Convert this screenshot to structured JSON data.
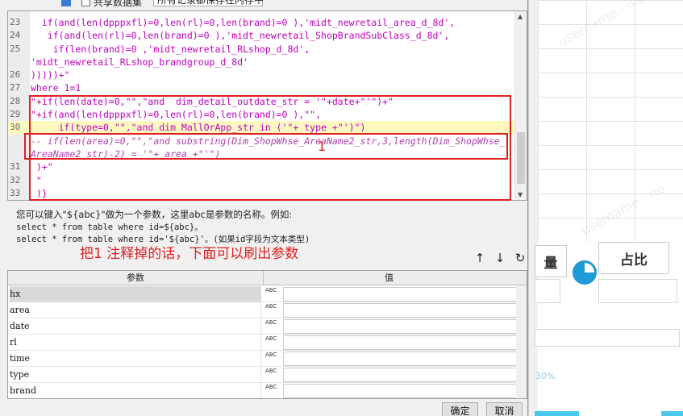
{
  "toolbar": {
    "share_label": "共享数据集",
    "records_dropdown": "所有记录都保存在内存中"
  },
  "editor": {
    "lines": [
      {
        "num": "23",
        "text": "  if(and(len(dpppxfl)=0,len(rl)=0,len(brand)=0 ),'midt_newretail_area_d_8d',"
      },
      {
        "num": "24",
        "text": "   if(and(len(rl)=0,len(brand)=0 ),'midt_newretail_ShopBrandSubClass_d_8d',"
      },
      {
        "num": "25",
        "text": "    if(len(brand)=0 ,'midt_newretail_RLshop_d_8d',"
      },
      {
        "num": "",
        "text": "'midt_newretail_RLshop_brandgroup_d_8d'"
      },
      {
        "num": "26",
        "text": ")))))+\""
      },
      {
        "num": "27",
        "text": "where 1=1"
      },
      {
        "num": "28",
        "text": "\"+if(len(date)=0,\"\",\"and  dim_detail_outdate_str = '\"+date+\"'\")+\""
      },
      {
        "num": "29",
        "text": "\"+if(and(len(dpppxfl)=0,len(rl)=0,len(brand)=0 ),\"\","
      },
      {
        "num": "30",
        "text": "     if(type=0,\"\",\"and dim MallOrApp_str in ('\"+ type +\"')\")"
      },
      {
        "num": "",
        "text": "-- if(len(area)=0,\"\",\"and substring(Dim_ShopWhse_AreaName2_str,3,length(Dim_ShopWhse_"
      },
      {
        "num": "",
        "text": "AreaName2_str)-2) = '\"+ area +\"'\")"
      },
      {
        "num": "31",
        "text": " )+\""
      },
      {
        "num": "32",
        "text": " \""
      },
      {
        "num": "33",
        "text": " )}"
      }
    ]
  },
  "annotation": {
    "marker": "1",
    "text": "把1 注释掉的话，下面可以刷出参数"
  },
  "hint": {
    "line1": "您可以键入\"${abc}\"做为一个参数，这里abc是参数的名称。例如:",
    "line2": "select * from table where id=${abc}。",
    "line3": "select * from table where id='${abc}'。(如果id字段为文本类型)"
  },
  "params_table": {
    "col_param": "参数",
    "col_value": "值",
    "type_icon_text": "ABC",
    "rows": [
      {
        "name": "hx",
        "value": ""
      },
      {
        "name": "area",
        "value": ""
      },
      {
        "name": "date",
        "value": ""
      },
      {
        "name": "rl",
        "value": ""
      },
      {
        "name": "time",
        "value": ""
      },
      {
        "name": "type",
        "value": ""
      },
      {
        "name": "brand",
        "value": ""
      }
    ]
  },
  "buttons": {
    "ok": "确定",
    "cancel": "取消"
  },
  "background_app": {
    "btn_qty": "量",
    "btn_ratio": "占比",
    "percent": "30%"
  }
}
